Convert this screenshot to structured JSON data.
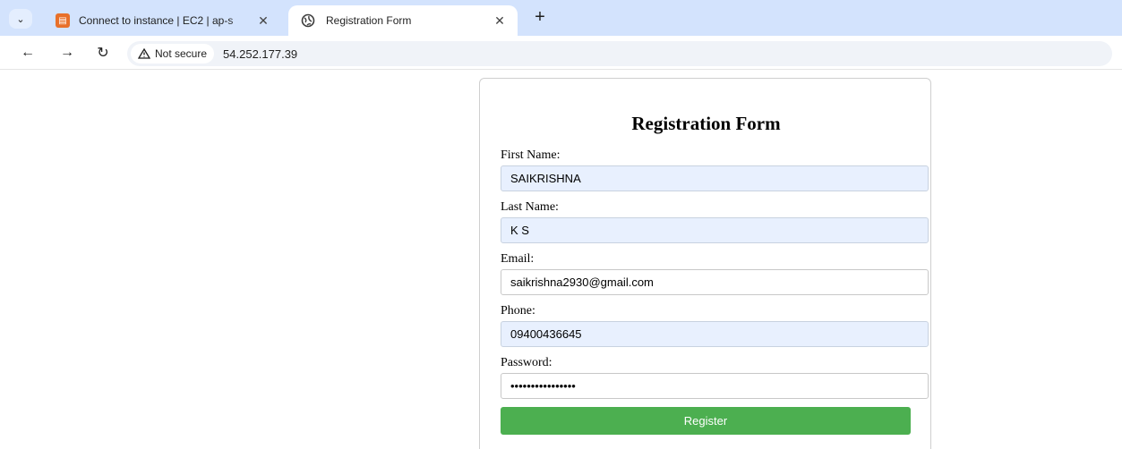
{
  "browser": {
    "tabs": [
      {
        "title": "Connect to instance | EC2 | ap-s",
        "active": false
      },
      {
        "title": "Registration Form",
        "active": true
      }
    ],
    "address": {
      "security_label": "Not secure",
      "url": "54.252.177.39"
    }
  },
  "form": {
    "title": "Registration Form",
    "fields": [
      {
        "label": "First Name:",
        "value": "SAIKRISHNA",
        "type": "text",
        "autofill": true
      },
      {
        "label": "Last Name:",
        "value": "K S",
        "type": "text",
        "autofill": true
      },
      {
        "label": "Email:",
        "value": "saikrishna2930@gmail.com",
        "type": "email",
        "autofill": false
      },
      {
        "label": "Phone:",
        "value": "09400436645",
        "type": "tel",
        "autofill": true
      },
      {
        "label": "Password:",
        "value": "••••••••••••••••",
        "type": "password",
        "autofill": false
      }
    ],
    "submit_label": "Register"
  },
  "colors": {
    "tabstrip": "#d3e3fd",
    "submit": "#4caf50",
    "autofill": "#e8f0fe"
  }
}
